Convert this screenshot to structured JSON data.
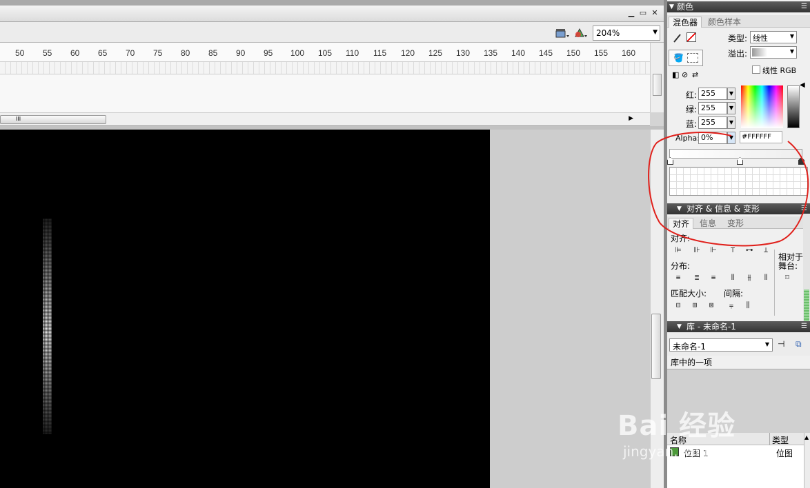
{
  "window": {
    "minimize_glyph": "▁",
    "restore_glyph": "▭",
    "close_glyph": "✕"
  },
  "toolbar": {
    "zoom_value": "204%"
  },
  "ruler": {
    "ticks": [
      "50",
      "55",
      "60",
      "65",
      "70",
      "75",
      "80",
      "85",
      "90",
      "95",
      "100",
      "105",
      "110",
      "115",
      "120",
      "125",
      "130",
      "135",
      "140",
      "145",
      "150",
      "155",
      "160"
    ]
  },
  "scrollbar": {
    "grip": "III"
  },
  "color_panel": {
    "title": "颜色",
    "tabs": [
      "混色器",
      "颜色样本"
    ],
    "type_label": "类型:",
    "type_value": "线性",
    "overflow_label": "溢出:",
    "linear_rgb_label": "线性 RGB",
    "red_label": "红:",
    "red_value": "255",
    "green_label": "绿:",
    "green_value": "255",
    "blue_label": "蓝:",
    "blue_value": "255",
    "alpha_label": "Alpha:",
    "alpha_value": "0%",
    "hex_value": "#FFFFFF"
  },
  "align_panel": {
    "title": "对齐 & 信息 & 变形",
    "tabs": [
      "对齐",
      "信息",
      "变形"
    ],
    "align_label": "对齐:",
    "distribute_label": "分布:",
    "match_size_label": "匹配大小:",
    "spacing_label": "间隔:",
    "relative_label_1": "相对于",
    "relative_label_2": "舞台:"
  },
  "library_panel": {
    "title": "库 - 未命名-1",
    "doc_select": "未命名-1",
    "count_text": "库中的一项",
    "col_name": "名称",
    "col_type": "类型",
    "items": [
      {
        "name": "位图 1",
        "type": "位图"
      }
    ]
  },
  "watermark": {
    "big": "Bai 经验",
    "small": "jingyan.baidu.com"
  },
  "colors": {
    "stage": "#000000",
    "annotation": "#e0201b",
    "panel_title": "#444444"
  }
}
